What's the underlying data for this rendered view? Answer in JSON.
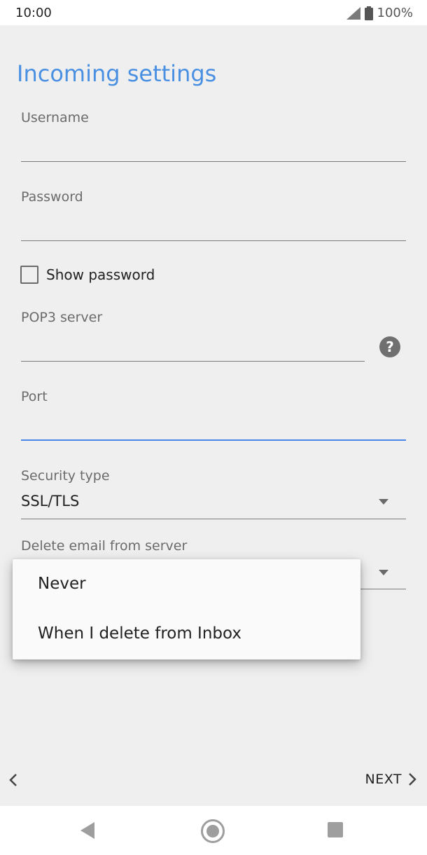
{
  "status": {
    "time": "10:00",
    "battery": "100%",
    "signal_icon": "signal-icon",
    "battery_icon": "battery-icon"
  },
  "page": {
    "title": "Incoming settings"
  },
  "fields": {
    "username": {
      "label": "Username",
      "value": ""
    },
    "password": {
      "label": "Password",
      "value": ""
    },
    "show_password": {
      "label": "Show password",
      "checked": false
    },
    "pop3_server": {
      "label": "POP3 server",
      "value": ""
    },
    "port": {
      "label": "Port",
      "value": ""
    },
    "security_type": {
      "label": "Security type",
      "value": "SSL/TLS"
    },
    "delete_email": {
      "label": "Delete email from server"
    }
  },
  "delete_menu": {
    "options": [
      "Never",
      "When I delete from Inbox"
    ]
  },
  "footer": {
    "next_label": "NEXT",
    "back_icon": "chevron-left-icon",
    "next_icon": "chevron-right-icon"
  },
  "navbar": {
    "back": "back-icon",
    "home": "home-icon",
    "recents": "recents-icon"
  }
}
